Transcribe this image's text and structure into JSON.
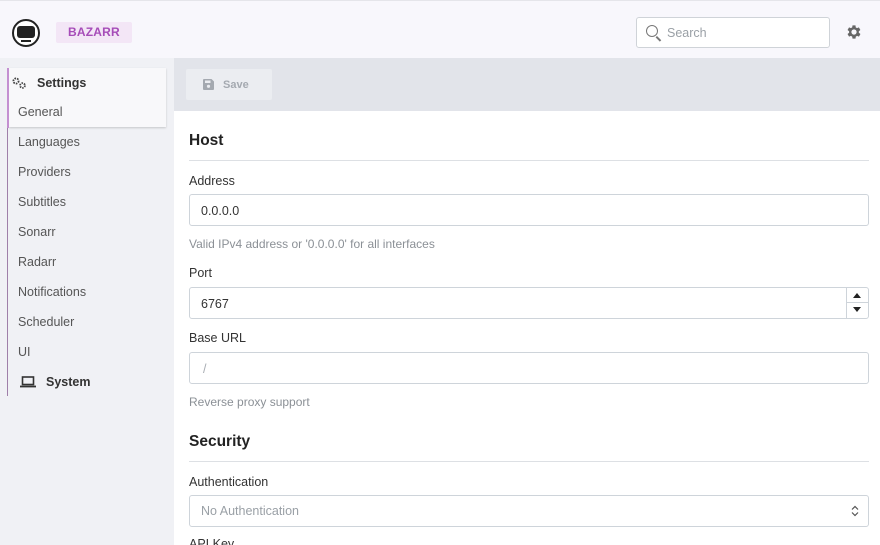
{
  "header": {
    "brand": "BAZARR",
    "search_placeholder": "Search"
  },
  "sidebar": {
    "settings_label": "Settings",
    "items": [
      "General",
      "Languages",
      "Providers",
      "Subtitles",
      "Sonarr",
      "Radarr",
      "Notifications",
      "Scheduler",
      "UI"
    ],
    "system_label": "System"
  },
  "toolbar": {
    "save_label": "Save"
  },
  "host": {
    "title": "Host",
    "address_label": "Address",
    "address_value": "0.0.0.0",
    "address_help": "Valid IPv4 address or '0.0.0.0' for all interfaces",
    "port_label": "Port",
    "port_value": "6767",
    "base_url_label": "Base URL",
    "base_url_placeholder": "/",
    "base_url_help": "Reverse proxy support"
  },
  "security": {
    "title": "Security",
    "auth_label": "Authentication",
    "auth_value": "No Authentication",
    "api_key_label": "API Key"
  },
  "colors": {
    "accent": "#a64cb8",
    "brand_bg": "#f3e6f6"
  }
}
